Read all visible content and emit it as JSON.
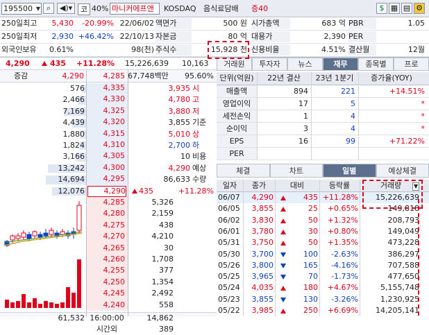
{
  "toolbar": {
    "code": "195500",
    "market_badge": "코",
    "margin_rate": "40%",
    "stock_name": "마니커에프앤",
    "exchange": "KOSDAQ",
    "sector": "음식료담배",
    "margin_label": "증40"
  },
  "info": {
    "rows": [
      {
        "label": "250일최고",
        "value": "5,430",
        "pct": "-20.99%",
        "date": "22/06/02",
        "k1": "액면가",
        "v1": "500 원",
        "k2": "시가총액",
        "v2": "683 억",
        "k3": "PBR",
        "v3": "1.05"
      },
      {
        "label": "250일최저",
        "value": "2,930",
        "pct": "+46.42%",
        "date": "22/10/13",
        "k1": "자본금",
        "v1": "80 억",
        "k2": "대용가",
        "v2": "2,390",
        "k3": "PER",
        "v3": ""
      },
      {
        "label": "외국인보유",
        "value": "0.61%",
        "pct": "",
        "date": "98(천)",
        "k1": "주식수",
        "v1": "15,928 천",
        "k2": "신용비율",
        "v2": "4.51%",
        "k3": "결산월",
        "v3": "12월"
      }
    ]
  },
  "quote": {
    "price": "4,290",
    "change": "435",
    "change_pct": "+11.28%",
    "volume": "15,226,639",
    "volume_extra": "10,163"
  },
  "orderbook": {
    "header_left": "증감",
    "header_price": "4,290",
    "header_price2": "4,285",
    "header_amount": "67,748백만",
    "header_pct": "95.60%",
    "asks": [
      {
        "qty": "576",
        "price": "4,335",
        "bar": 0.1
      },
      {
        "qty": "2,466",
        "price": "4,330",
        "bar": 0.2
      },
      {
        "qty": "7,169",
        "price": "4,325",
        "bar": 0.55
      },
      {
        "qty": "4,439",
        "price": "4,320",
        "bar": 0.35
      },
      {
        "qty": "1,880",
        "price": "4,315",
        "bar": 0.15
      },
      {
        "qty": "1,824",
        "price": "4,310",
        "bar": 0.15
      },
      {
        "qty": "3,166",
        "price": "4,305",
        "bar": 0.25
      },
      {
        "qty": "13,242",
        "price": "4,300",
        "bar": 0.95
      },
      {
        "qty": "14,694",
        "price": "4,295",
        "bar": 1.0
      },
      {
        "qty": "12,076",
        "price": "4,290",
        "bar": 0.85
      }
    ],
    "bids": [
      {
        "price": "4,285",
        "qty": "5,326"
      },
      {
        "price": "4,280",
        "qty": "2,159"
      },
      {
        "price": "4,275",
        "qty": "438"
      },
      {
        "price": "4,270",
        "qty": "4,210"
      },
      {
        "price": "4,265",
        "qty": "30"
      },
      {
        "price": "4,260",
        "qty": "1,708"
      },
      {
        "price": "4,255",
        "qty": "377"
      },
      {
        "price": "4,250",
        "qty": "1,354"
      },
      {
        "price": "4,245",
        "qty": "2,492"
      },
      {
        "price": "4,240",
        "qty": "558"
      }
    ],
    "summary": [
      {
        "value": "3,935",
        "label": "시"
      },
      {
        "value": "4,780",
        "label": "고"
      },
      {
        "value": "3,880",
        "label": "저"
      },
      {
        "value": "3,855",
        "label": "기준"
      },
      {
        "value": "5,010",
        "label": "상"
      },
      {
        "value": "2,700",
        "label": "하"
      },
      {
        "value": "10",
        "label": "비용"
      }
    ],
    "expected_price": "4,290",
    "expected_price_label": "예상",
    "expected_qty": "86,633",
    "expected_qty_label": "수량",
    "expected_change": "435",
    "expected_pct": "+11.28%",
    "total_ask": "61,532",
    "time": "16:00:00",
    "total_bid": "14,862",
    "after_label": "시간외",
    "after_value": "389"
  },
  "fin_tabs": [
    "거래원",
    "투자자",
    "뉴스",
    "재무",
    "종목별",
    "프로"
  ],
  "fin_active": 3,
  "financials": {
    "headers": [
      "단위(억원)",
      "22년 결산",
      "23년 1분기",
      "증가율(YOY)"
    ],
    "rows": [
      {
        "label": "매출액",
        "a": "894",
        "b": "221",
        "c": "+14.51%"
      },
      {
        "label": "영업이익",
        "a": "17",
        "b": "5",
        "c": "*"
      },
      {
        "label": "세전손익",
        "a": "1",
        "b": "4",
        "c": "*"
      },
      {
        "label": "순이익",
        "a": "3",
        "b": "4",
        "c": "*"
      },
      {
        "label": "EPS",
        "a": "16",
        "b": "99",
        "c": "+71.22%"
      },
      {
        "label": "PER",
        "a": "",
        "b": "",
        "c": ""
      }
    ]
  },
  "daily_tabs": [
    "체결",
    "차트",
    "일별",
    "예상체결"
  ],
  "daily_active": 2,
  "daily": {
    "headers": [
      "일자",
      "종가",
      "대비",
      "등락률",
      "거래량"
    ],
    "rows": [
      {
        "date": "06/07",
        "close": "4,290",
        "dir": "up",
        "chg": "435",
        "pct": "+11.28%",
        "vol": "15,226,639"
      },
      {
        "date": "06/05",
        "close": "3,855",
        "dir": "up",
        "chg": "25",
        "pct": "+0.65%",
        "vol": "149,818"
      },
      {
        "date": "06/02",
        "close": "3,830",
        "dir": "up",
        "chg": "50",
        "pct": "+1.32%",
        "vol": "208,793"
      },
      {
        "date": "06/01",
        "close": "3,780",
        "dir": "up",
        "chg": "30",
        "pct": "+0.80%",
        "vol": "149,049"
      },
      {
        "date": "05/31",
        "close": "3,750",
        "dir": "up",
        "chg": "50",
        "pct": "+1.35%",
        "vol": "473,228"
      },
      {
        "date": "05/30",
        "close": "3,700",
        "dir": "down",
        "chg": "100",
        "pct": "-2.63%",
        "vol": "386,297"
      },
      {
        "date": "05/26",
        "close": "3,800",
        "dir": "down",
        "chg": "165",
        "pct": "-4.16%",
        "vol": "707,588"
      },
      {
        "date": "05/25",
        "close": "3,965",
        "dir": "down",
        "chg": "70",
        "pct": "-1.73%",
        "vol": "477,650"
      },
      {
        "date": "05/24",
        "close": "4,035",
        "dir": "up",
        "chg": "180",
        "pct": "+4.67%",
        "vol": "5,155,748"
      },
      {
        "date": "05/23",
        "close": "3,855",
        "dir": "down",
        "chg": "130",
        "pct": "-3.26%",
        "vol": "1,230,925"
      },
      {
        "date": "05/22",
        "close": "3,985",
        "dir": "up",
        "chg": "250",
        "pct": "+6.69%",
        "vol": "14,205,141"
      }
    ]
  },
  "colors": {
    "up": "#e0001b",
    "down": "#1040c0",
    "ask_bg": "#e8eef8",
    "bid_bg": "#fbe9e9",
    "highlight": "#e0001b"
  }
}
